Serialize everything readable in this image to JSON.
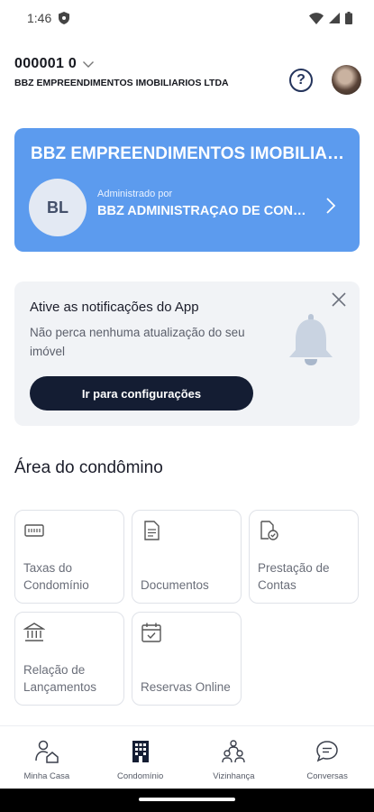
{
  "status_bar": {
    "time": "1:46"
  },
  "header": {
    "account_id": "000001 0",
    "account_name": "BBZ EMPREENDIMENTOS IMOBILIARIOS LTDA"
  },
  "condo_card": {
    "title": "BBZ EMPREENDIMENTOS IMOBILIARIOS LTDA",
    "initials": "BL",
    "admin_label": "Administrado por",
    "admin_name": "BBZ ADMINISTRAÇAO DE CONDOMINIOS"
  },
  "notification": {
    "title": "Ative as notificações do App",
    "text": "Não perca nenhuma atualização do seu imóvel",
    "button_label": "Ir para configurações"
  },
  "section": {
    "title": "Área do condômino"
  },
  "tiles": [
    {
      "label": "Taxas do Condomínio",
      "icon": "fee-icon"
    },
    {
      "label": "Documentos",
      "icon": "document-icon"
    },
    {
      "label": "Prestação de Contas",
      "icon": "accountability-icon"
    },
    {
      "label": "Relação de Lançamentos",
      "icon": "bank-icon"
    },
    {
      "label": "Reservas Online",
      "icon": "calendar-icon"
    }
  ],
  "bottom_nav": [
    {
      "label": "Minha Casa",
      "icon": "home-user-icon"
    },
    {
      "label": "Condomínio",
      "icon": "building-icon",
      "active": true
    },
    {
      "label": "Vizinhança",
      "icon": "neighbors-icon"
    },
    {
      "label": "Conversas",
      "icon": "chat-icon"
    }
  ],
  "colors": {
    "card_blue": "#5c9bee",
    "dark_navy": "#141d33",
    "soft_gray": "#f1f3f6"
  }
}
